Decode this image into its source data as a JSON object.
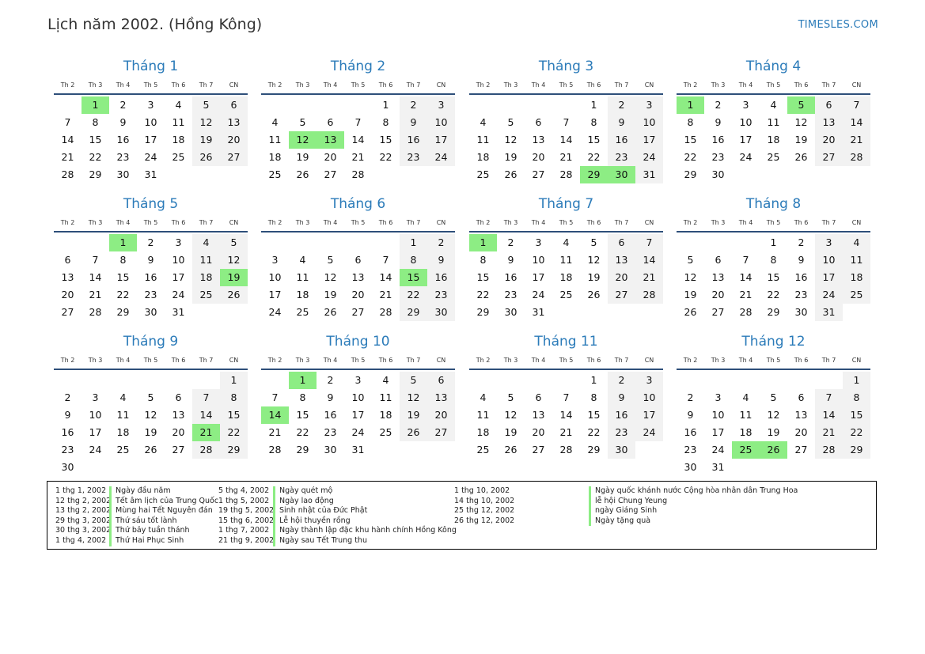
{
  "header": {
    "title": "Lịch năm 2002. (Hồng Kông)",
    "site": "TIMESLES.COM"
  },
  "weekdays": [
    "Th 2",
    "Th 3",
    "Th 4",
    "Th 5",
    "Th 6",
    "Th 7",
    "CN"
  ],
  "months": [
    {
      "name": "Tháng 1",
      "days": 31,
      "start": 1,
      "holidays": [
        1
      ]
    },
    {
      "name": "Tháng 2",
      "days": 28,
      "start": 4,
      "holidays": [
        12,
        13
      ]
    },
    {
      "name": "Tháng 3",
      "days": 31,
      "start": 4,
      "holidays": [
        29,
        30
      ]
    },
    {
      "name": "Tháng 4",
      "days": 30,
      "start": 0,
      "holidays": [
        1,
        5
      ]
    },
    {
      "name": "Tháng 5",
      "days": 31,
      "start": 2,
      "holidays": [
        1,
        19
      ]
    },
    {
      "name": "Tháng 6",
      "days": 30,
      "start": 5,
      "holidays": [
        15
      ]
    },
    {
      "name": "Tháng 7",
      "days": 31,
      "start": 0,
      "holidays": [
        1
      ]
    },
    {
      "name": "Tháng 8",
      "days": 31,
      "start": 3,
      "holidays": []
    },
    {
      "name": "Tháng 9",
      "days": 30,
      "start": 6,
      "holidays": [
        21
      ]
    },
    {
      "name": "Tháng 10",
      "days": 31,
      "start": 1,
      "holidays": [
        1,
        14
      ]
    },
    {
      "name": "Tháng 11",
      "days": 30,
      "start": 4,
      "holidays": []
    },
    {
      "name": "Tháng 12",
      "days": 31,
      "start": 6,
      "holidays": [
        25,
        26
      ]
    }
  ],
  "holiday_list": [
    [
      {
        "date": "1 thg 1, 2002",
        "name": "Ngày đầu năm"
      },
      {
        "date": "12 thg 2, 2002",
        "name": "Tết âm lịch của Trung Quốc"
      },
      {
        "date": "13 thg 2, 2002",
        "name": "Mùng hai Tết Nguyên đán"
      },
      {
        "date": "29 thg 3, 2002",
        "name": "Thứ sáu tốt lành"
      },
      {
        "date": "30 thg 3, 2002",
        "name": "Thứ bảy tuần thánh"
      },
      {
        "date": "1 thg 4, 2002",
        "name": "Thứ Hai Phục Sinh"
      }
    ],
    [
      {
        "date": "5 thg 4, 2002",
        "name": "Ngày quét mộ"
      },
      {
        "date": "1 thg 5, 2002",
        "name": "Ngày lao động"
      },
      {
        "date": "19 thg 5, 2002",
        "name": "Sinh nhật của Đức Phật"
      },
      {
        "date": "15 thg 6, 2002",
        "name": "Lễ hội thuyền rồng"
      },
      {
        "date": "1 thg 7, 2002",
        "name": "Ngày thành lập đặc khu hành chính Hồng Kông"
      },
      {
        "date": "21 thg 9, 2002",
        "name": "Ngày sau Tết Trung thu"
      }
    ],
    [
      {
        "date": "1 thg 10, 2002",
        "name": "Ngày quốc khánh nước Cộng hòa nhân dân Trung Hoa"
      },
      {
        "date": "14 thg 10, 2002",
        "name": "lễ hội Chung Yeung"
      },
      {
        "date": "25 thg 12, 2002",
        "name": "ngày Giáng Sinh"
      },
      {
        "date": "26 thg 12, 2002",
        "name": "Ngày tặng quà"
      }
    ]
  ],
  "colors": {
    "holiday": "#8ded84",
    "weekend": "#f2f2f2",
    "accent": "#2b7bb9",
    "rule": "#2e4f7a"
  }
}
